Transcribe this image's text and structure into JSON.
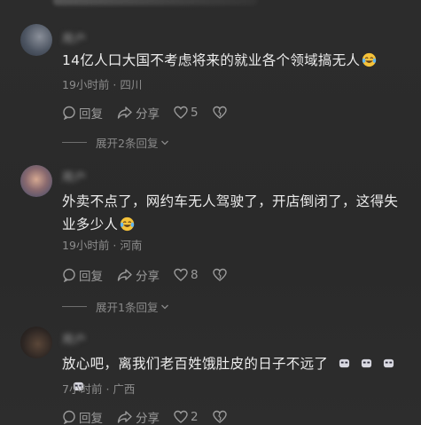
{
  "comments": [
    {
      "username": "用户",
      "text": "14亿人口大国不考虑将来的就业各个领域搞无人",
      "time": "19小时前",
      "location": "四川",
      "reply_label": "回复",
      "share_label": "分享",
      "like_count": "5",
      "expand_label": "展开2条回复"
    },
    {
      "username": "用户",
      "text": "外卖不点了，网约车无人驾驶了，开店倒闭了，这得失业多少人",
      "time": "19小时前",
      "location": "河南",
      "reply_label": "回复",
      "share_label": "分享",
      "like_count": "8",
      "expand_label": "展开1条回复"
    },
    {
      "username": "用户",
      "text": "放心吧，离我们老百姓饿肚皮的日子不远了",
      "time": "7小时前",
      "location": "广西",
      "reply_label": "回复",
      "share_label": "分享",
      "like_count": "2"
    }
  ],
  "meta_separator": "·",
  "icons": {
    "reply": "comment-bubble-icon",
    "share": "share-arrow-icon",
    "like": "heart-icon",
    "dislike": "broken-heart-icon",
    "expand": "chevron-down-icon",
    "laugh": "laughing-tears-emoji",
    "speechless": "speechless-face-emoji"
  }
}
